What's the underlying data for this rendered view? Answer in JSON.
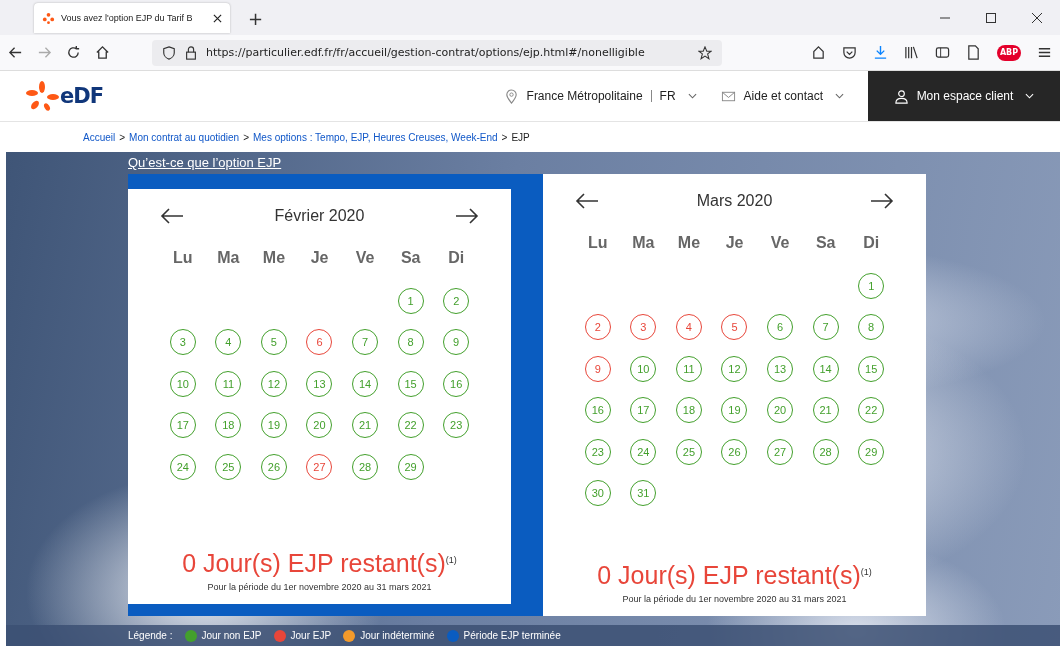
{
  "browser": {
    "tab_title": "Vous avez l'option EJP du Tarif B",
    "new_tab": "+",
    "url": "https://particulier.edf.fr/fr/accueil/gestion-contrat/options/ejp.html#/nonelligible",
    "adblock": "ABP"
  },
  "header": {
    "logo": "eDF",
    "region": "France Métropolitaine",
    "lang": "FR",
    "help": "Aide et contact",
    "account": "Mon espace client"
  },
  "breadcrumb": [
    {
      "label": "Accueil",
      "current": false
    },
    {
      "separator": ">",
      "label": "Mon contrat au quotidien",
      "current": false
    },
    {
      "separator": ">",
      "label": "Mes options : Tempo, EJP, Heures Creuses, Week-End",
      "current": false
    },
    {
      "separator": ">",
      "label": "EJP",
      "current": true
    }
  ],
  "intro_link": "Qu’est-ce que l’option EJP",
  "calendars": [
    {
      "month": "Février 2020",
      "weekdays": [
        "Lu",
        "Ma",
        "Me",
        "Je",
        "Ve",
        "Sa",
        "Di"
      ],
      "remaining": "0 Jour(s) EJP restant(s)$^{(1)}$",
      "period": "Pour la période du 1er novembre 2020 au 31 mars 2021",
      "weeks": [
        {
          "days": [
            {
              "label": "1",
              "color": "#43a02c"
            },
            {
              "label": "2",
              "color": "#43a02c"
            }
          ]
        },
        {
          "days": [
            {
              "label": "3",
              "color": "#43a02c"
            },
            {
              "label": "4",
              "color": "#43a02c"
            },
            {
              "label": "5",
              "color": "#43a02c"
            },
            {
              "label": "6",
              "color": "#e8463a"
            },
            {
              "label": "7",
              "color": "#43a02c"
            },
            {
              "label": "8",
              "color": "#43a02c"
            },
            {
              "label": "9",
              "color": "#43a02c"
            }
          ]
        },
        {
          "days": [
            {
              "label": "10",
              "color": "#43a02c"
            },
            {
              "label": "11",
              "color": "#43a02c"
            },
            {
              "label": "12",
              "color": "#43a02c"
            },
            {
              "label": "13",
              "color": "#43a02c"
            },
            {
              "label": "14",
              "color": "#43a02c"
            },
            {
              "label": "15",
              "color": "#43a02c"
            },
            {
              "label": "16",
              "color": "#43a02c"
            }
          ]
        },
        {
          "days": [
            {
              "label": "17",
              "color": "#43a02c"
            },
            {
              "label": "18",
              "color": "#43a02c"
            },
            {
              "label": "19",
              "color": "#43a02c"
            },
            {
              "label": "20",
              "color": "#43a02c"
            },
            {
              "label": "21",
              "color": "#43a02c"
            },
            {
              "label": "22",
              "color": "#43a02c"
            },
            {
              "label": "23",
              "color": "#43a02c"
            }
          ]
        },
        {
          "days": [
            {
              "label": "24",
              "color": "#43a02c"
            },
            {
              "label": "25",
              "color": "#43a02c"
            },
            {
              "label": "26",
              "color": "#43a02c"
            },
            {
              "label": "27",
              "color": "#e8463a"
            },
            {
              "label": "28",
              "color": "#43a02c"
            },
            {
              "label": "29",
              "color": "#43a02c"
            }
          ]
        }
      ]
    },
    {
      "month": "Mars 2020",
      "weekdays": [
        "Lu",
        "Ma",
        "Me",
        "Je",
        "Ve",
        "Sa",
        "Di"
      ],
      "remaining": "0 Jour(s) EJP restant(s)$^{(1)}$",
      "period": "Pour la période du 1er novembre 2020 au 31 mars 2021",
      "weeks": [
        {
          "days": [
            {
              "label": "1",
              "color": "#43a02c"
            }
          ]
        },
        {
          "days": [
            {
              "label": "2",
              "color": "#e8463a"
            },
            {
              "label": "3",
              "color": "#e8463a"
            },
            {
              "label": "4",
              "color": "#e8463a"
            },
            {
              "label": "5",
              "color": "#e8463a"
            },
            {
              "label": "6",
              "color": "#43a02c"
            },
            {
              "label": "7",
              "color": "#43a02c"
            },
            {
              "label": "8",
              "color": "#43a02c"
            }
          ]
        },
        {
          "days": [
            {
              "label": "9",
              "color": "#e8463a"
            },
            {
              "label": "10",
              "color": "#43a02c"
            },
            {
              "label": "11",
              "color": "#43a02c"
            },
            {
              "label": "12",
              "color": "#43a02c"
            },
            {
              "label": "13",
              "color": "#43a02c"
            },
            {
              "label": "14",
              "color": "#43a02c"
            },
            {
              "label": "15",
              "color": "#43a02c"
            }
          ]
        },
        {
          "days": [
            {
              "label": "16",
              "color": "#43a02c"
            },
            {
              "label": "17",
              "color": "#43a02c"
            },
            {
              "label": "18",
              "color": "#43a02c"
            },
            {
              "label": "19",
              "color": "#43a02c"
            },
            {
              "label": "20",
              "color": "#43a02c"
            },
            {
              "label": "21",
              "color": "#43a02c"
            },
            {
              "label": "22",
              "color": "#43a02c"
            }
          ]
        },
        {
          "days": [
            {
              "label": "23",
              "color": "#43a02c"
            },
            {
              "label": "24",
              "color": "#43a02c"
            },
            {
              "label": "25",
              "color": "#43a02c"
            },
            {
              "label": "26",
              "color": "#43a02c"
            },
            {
              "label": "27",
              "color": "#43a02c"
            },
            {
              "label": "28",
              "color": "#43a02c"
            },
            {
              "label": "29",
              "color": "#43a02c"
            }
          ]
        },
        {
          "days": [
            {
              "label": "30",
              "color": "#43a02c"
            },
            {
              "label": "31",
              "color": "#43a02c"
            }
          ]
        }
      ]
    }
  ],
  "legend": {
    "title": "Légende :",
    "items": [
      {
        "label": "Jour non EJP",
        "color": "#43a02c"
      },
      {
        "label": "Jour EJP",
        "color": "#e8463a"
      },
      {
        "label": "Jour indéterminé",
        "color": "#f39a2b"
      },
      {
        "label": "Période EJP terminée",
        "color": "#0a5cc0"
      }
    ]
  }
}
